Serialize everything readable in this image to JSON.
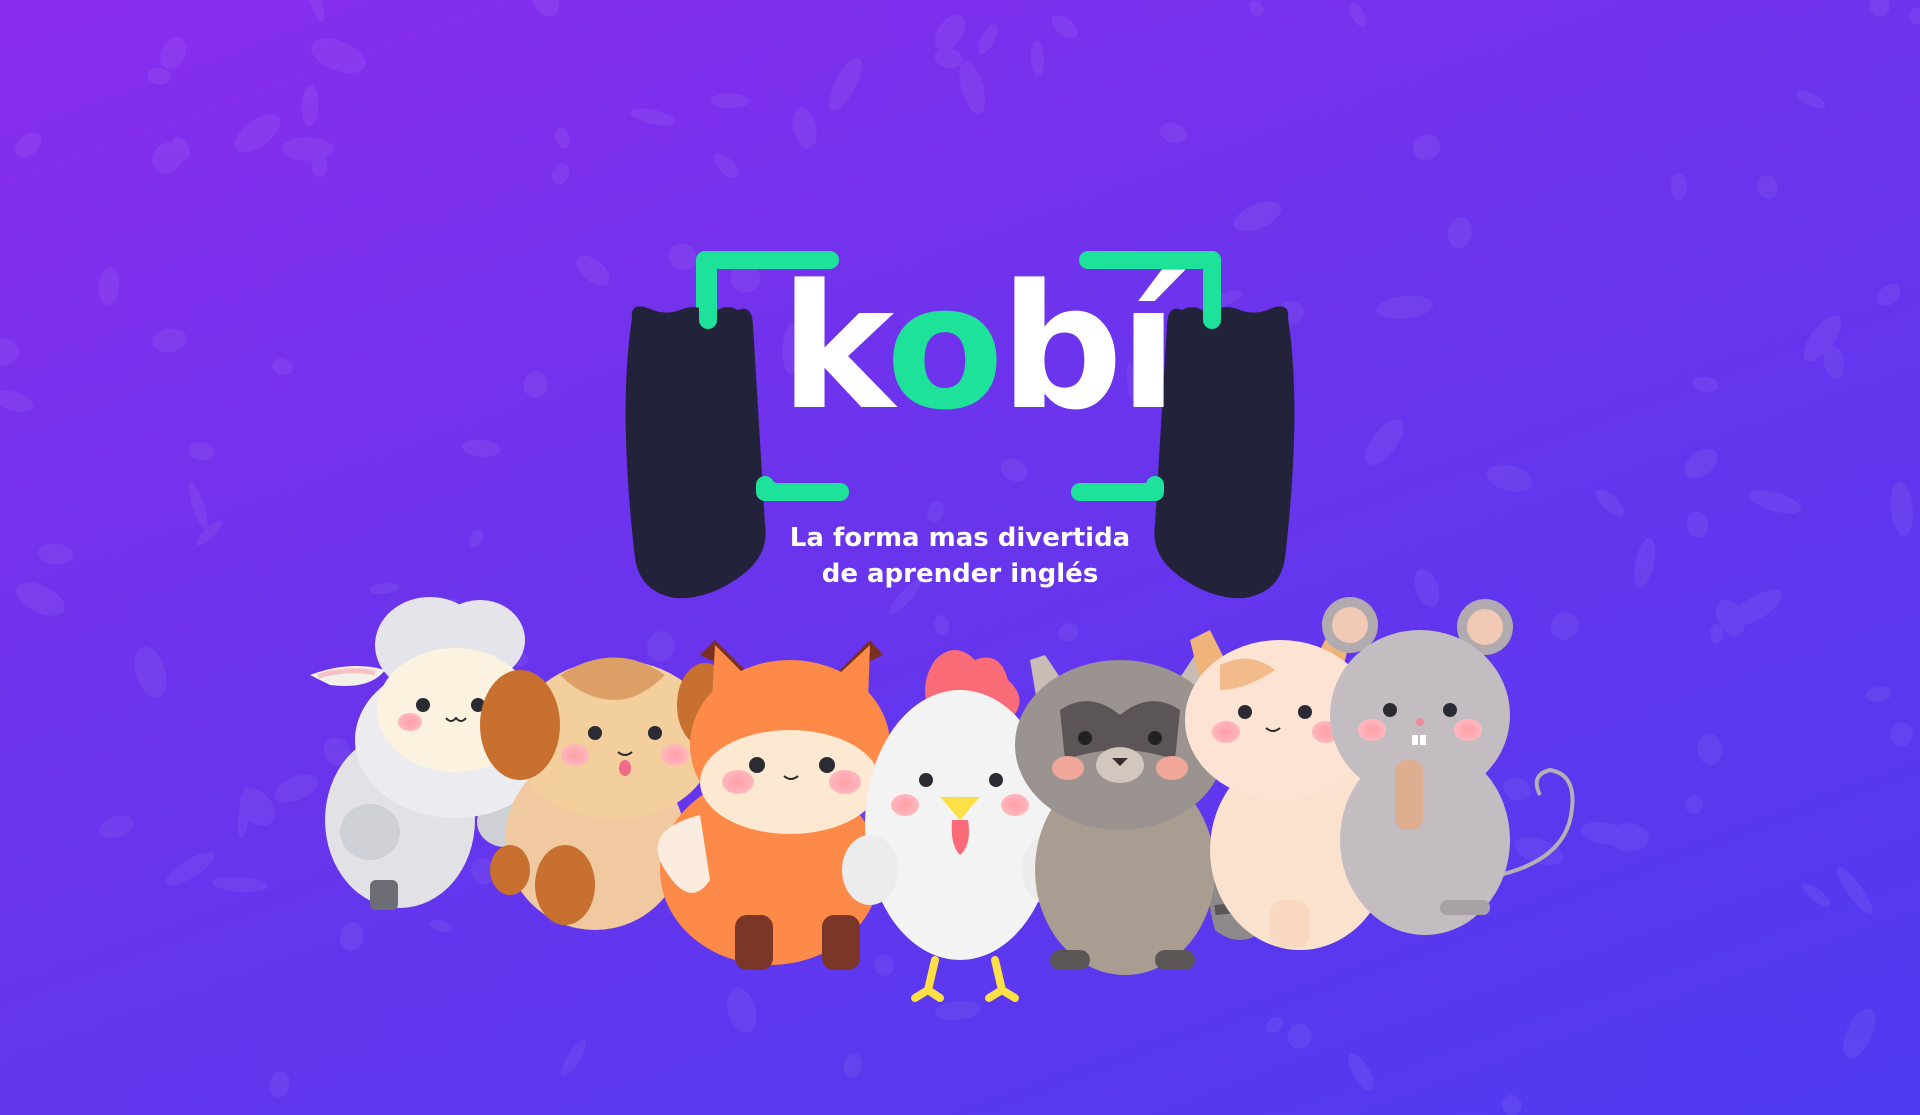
{
  "brand": {
    "name_parts": [
      "k",
      "o",
      "bí"
    ],
    "tagline_line1": "La forma mas divertida",
    "tagline_line2": "de aprender inglés"
  },
  "colors": {
    "background_top": "#8a2ded",
    "background_bottom": "#4f3bf0",
    "accent_green": "#1ee29a",
    "logo_dark": "#22223a",
    "text": "#ffffff"
  },
  "characters": [
    "sheep",
    "puppy",
    "fox",
    "chicken",
    "raccoon",
    "cat",
    "mouse"
  ]
}
